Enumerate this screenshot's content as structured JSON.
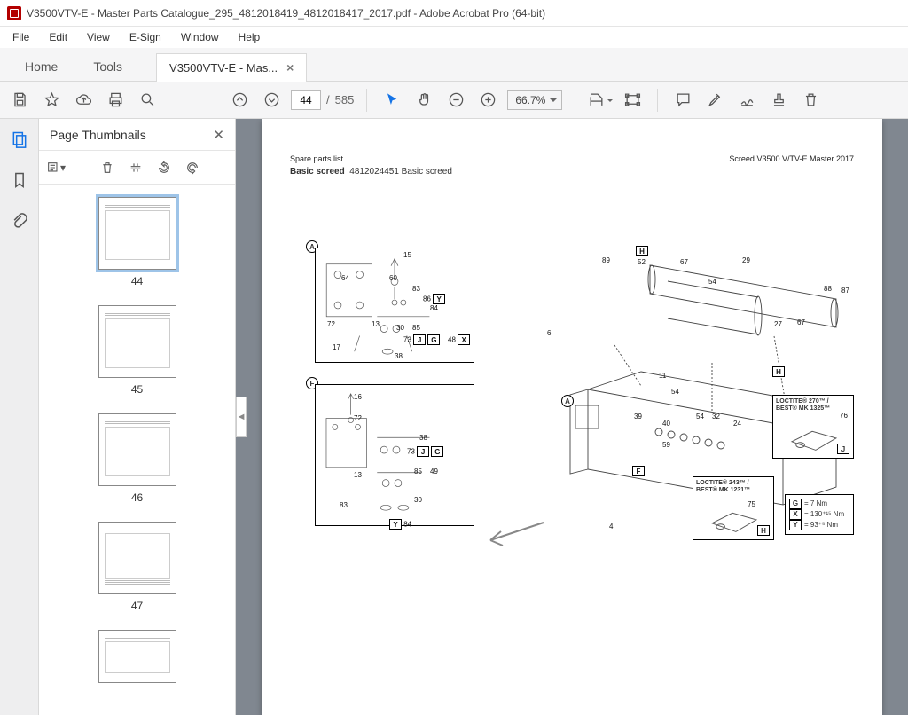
{
  "window": {
    "title": "V3500VTV-E - Master Parts Catalogue_295_4812018419_4812018417_2017.pdf - Adobe Acrobat Pro (64-bit)"
  },
  "menus": [
    "File",
    "Edit",
    "View",
    "E-Sign",
    "Window",
    "Help"
  ],
  "nav_tabs": {
    "home": "Home",
    "tools": "Tools",
    "document": "V3500VTV-E - Mas..."
  },
  "toolbar": {
    "current_page": "44",
    "total_pages": "585",
    "page_sep": "/",
    "zoom": "66.7%"
  },
  "thumbnails": {
    "title": "Page Thumbnails",
    "items": [
      {
        "page": "44",
        "selected": true
      },
      {
        "page": "45",
        "selected": false
      },
      {
        "page": "46",
        "selected": false
      },
      {
        "page": "47",
        "selected": false
      }
    ]
  },
  "page": {
    "header_left": "Spare parts list",
    "header_right": "Screed V3500 V/TV-E Master 2017",
    "title_bold": "Basic screed",
    "title_rest": "4812024451 Basic screed",
    "callouts": {
      "A": "A",
      "F": "F",
      "H": "H",
      "J": "J"
    },
    "part_numbers": [
      "64",
      "15",
      "60",
      "83",
      "86",
      "84",
      "72",
      "13",
      "30",
      "85",
      "73",
      "48",
      "17",
      "38",
      "16",
      "49",
      "89",
      "52",
      "67",
      "29",
      "54",
      "88",
      "87",
      "27",
      "6",
      "11",
      "39",
      "40",
      "32",
      "24",
      "59",
      "4",
      "76",
      "75"
    ],
    "letter_tags": [
      "Y",
      "J",
      "G",
      "X",
      "F",
      "H"
    ],
    "loctite1": "LOCTITE® 270™ / BEST® MK 1325™",
    "loctite2": "LOCTITE® 243™ / BEST® MK 1231™",
    "torques": [
      {
        "tag": "G",
        "val": "= 7 Nm"
      },
      {
        "tag": "X",
        "val": "= 130⁺¹⁵ Nm"
      },
      {
        "tag": "Y",
        "val": "= 93⁺⁵ Nm"
      }
    ]
  },
  "icons": {
    "save": "save-icon",
    "star": "star-icon",
    "cloud": "cloud-upload-icon",
    "print": "print-icon",
    "search": "search-icon",
    "page-up": "page-up-icon",
    "page-down": "page-down-icon",
    "pointer": "pointer-icon",
    "hand": "hand-icon",
    "zoom-out": "zoom-out-icon",
    "zoom-in": "zoom-in-icon",
    "crop": "crop-icon",
    "frame": "frame-icon",
    "comment": "comment-icon",
    "highlight": "highlight-icon",
    "sign": "sign-icon",
    "stamp": "stamp-icon",
    "trash": "trash-icon",
    "thumbnails": "thumbnails-icon",
    "bookmark": "bookmark-icon",
    "attach": "attach-icon"
  }
}
